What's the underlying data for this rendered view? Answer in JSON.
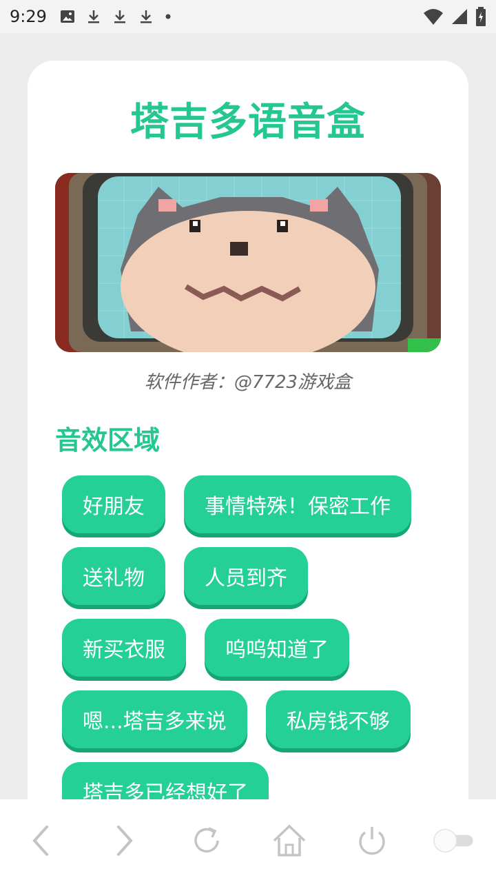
{
  "status_bar": {
    "time": "9:29",
    "icons": [
      "image-icon",
      "download-icon",
      "download-icon",
      "download-icon",
      "dot-icon"
    ],
    "right_icons": [
      "wifi-icon",
      "signal-icon",
      "battery-charging-icon"
    ]
  },
  "app": {
    "title": "塔吉多语音盒",
    "author": "软件作者：@7723游戏盒",
    "section_title": "音效区域",
    "accent_color": "#25c78f",
    "button_color": "#25d097"
  },
  "sound_buttons": [
    "好朋友",
    "事情特殊！保密工作",
    "送礼物",
    "人员到齐",
    "新买衣服",
    "呜呜知道了",
    "嗯...塔吉多来说",
    "私房钱不够",
    "塔吉多已经想好了"
  ],
  "nav_bar": {
    "icons": [
      "back-icon",
      "forward-icon",
      "refresh-icon",
      "home-icon",
      "power-icon",
      "toggle-switch"
    ]
  }
}
